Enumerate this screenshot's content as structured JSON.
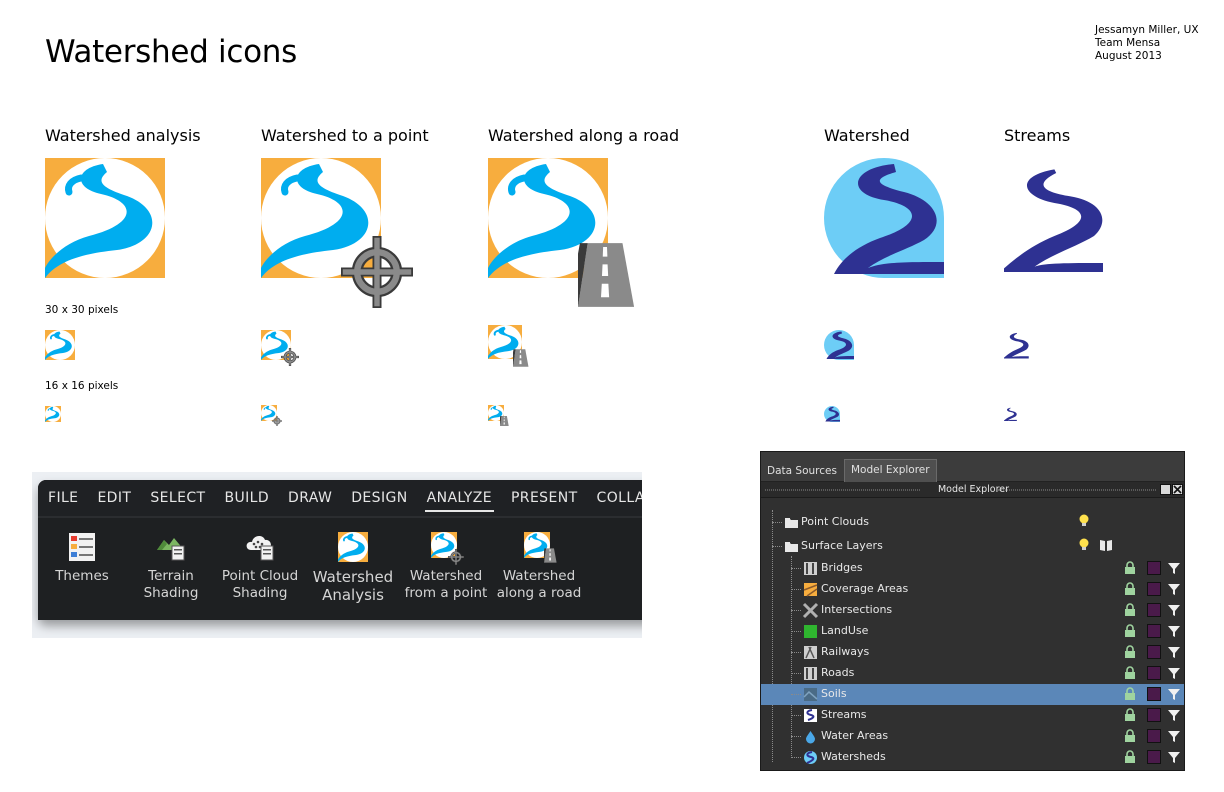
{
  "header": {
    "title": "Watershed icons",
    "credits": [
      "Jessamyn Miller, UX",
      "Team Mensa",
      "August 2013"
    ]
  },
  "icon_columns": [
    {
      "label": "Watershed analysis"
    },
    {
      "label": "Watershed to a point"
    },
    {
      "label": "Watershed along a road"
    },
    {
      "label": "Watershed"
    },
    {
      "label": "Streams"
    }
  ],
  "size_labels": {
    "medium": "30 x 30 pixels",
    "small": "16 x 16 pixels"
  },
  "colors": {
    "orange": "#f7ad3e",
    "cyan": "#00adef",
    "light_blue": "#6dcdf6",
    "navy": "#2e3192",
    "gray": "#8a8a8a",
    "dark_gray": "#3a3a3a"
  },
  "ribbon": {
    "menu": [
      "FILE",
      "EDIT",
      "SELECT",
      "BUILD",
      "DRAW",
      "DESIGN",
      "ANALYZE",
      "PRESENT",
      "COLLAB"
    ],
    "active_menu": "ANALYZE",
    "tools": [
      {
        "label": "Themes",
        "icon": "themes-icon"
      },
      {
        "label": "Terrain\nShading",
        "icon": "terrain-shading-icon"
      },
      {
        "label": "Point Cloud\nShading",
        "icon": "point-cloud-shading-icon"
      },
      {
        "label": "Watershed\nAnalysis",
        "icon": "watershed-analysis-icon"
      },
      {
        "label": "Watershed\nfrom a point",
        "icon": "watershed-point-icon"
      },
      {
        "label": "Watershed\nalong a road",
        "icon": "watershed-road-icon"
      }
    ]
  },
  "explorer": {
    "tabs": [
      "Data Sources",
      "Model Explorer"
    ],
    "active_tab": "Model Explorer",
    "panel_title": "Model Explorer",
    "groups": [
      "Point Clouds",
      "Surface Layers"
    ],
    "layers": [
      {
        "label": "Bridges",
        "icon": "bridge-icon"
      },
      {
        "label": "Coverage Areas",
        "icon": "coverage-icon"
      },
      {
        "label": "Intersections",
        "icon": "intersection-icon"
      },
      {
        "label": "LandUse",
        "icon": "landuse-icon"
      },
      {
        "label": "Railways",
        "icon": "railway-icon"
      },
      {
        "label": "Roads",
        "icon": "road-icon"
      },
      {
        "label": "Soils",
        "icon": "soils-icon"
      },
      {
        "label": "Streams",
        "icon": "streams-icon"
      },
      {
        "label": "Water Areas",
        "icon": "water-drop-icon"
      },
      {
        "label": "Watersheds",
        "icon": "watershed-icon"
      }
    ],
    "selected_layer": "Soils"
  }
}
